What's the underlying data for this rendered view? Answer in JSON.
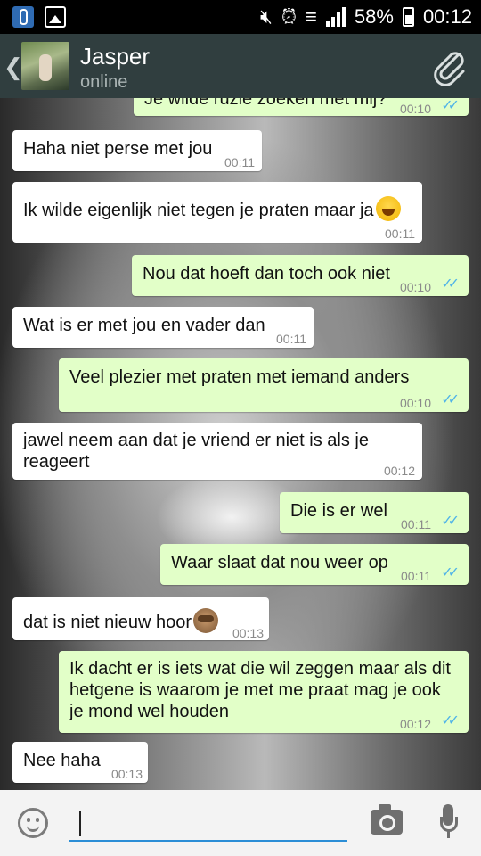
{
  "status_bar": {
    "battery": "58%",
    "time": "00:12",
    "icons": [
      "thermometer-icon",
      "gallery-icon",
      "mute-icon",
      "alarm-icon",
      "wifi-icon",
      "signal-icon",
      "battery-charging-icon"
    ]
  },
  "header": {
    "contact_name": "Jasper",
    "contact_status": "online",
    "icons": [
      "back-icon",
      "avatar",
      "attach-icon"
    ]
  },
  "messages": [
    {
      "dir": "out",
      "text": "Je wilde ruzie zoeken met mij?",
      "time": "00:10",
      "read": true
    },
    {
      "dir": "in",
      "text": "Haha niet perse met jou",
      "time": "00:11"
    },
    {
      "dir": "in",
      "text": "Ik wilde eigenlijk niet tegen je praten maar ja",
      "emoji": "face-with-tears-of-joy",
      "time": "00:11"
    },
    {
      "dir": "out",
      "text": "Nou dat hoeft dan toch ook niet",
      "time": "00:10",
      "read": true
    },
    {
      "dir": "in",
      "text": "Wat is er met jou en vader dan",
      "time": "00:11"
    },
    {
      "dir": "out",
      "text": "Veel plezier met praten met iemand anders",
      "time": "00:10",
      "read": true
    },
    {
      "dir": "in",
      "lines": [
        "jawel neem aan dat je vriend er niet is als je",
        "reageert"
      ],
      "time": "00:12"
    },
    {
      "dir": "out",
      "text": "Die is er wel",
      "time": "00:11",
      "read": true
    },
    {
      "dir": "out",
      "text": "Waar slaat dat nou weer op",
      "time": "00:11",
      "read": true
    },
    {
      "dir": "in",
      "text": "dat is niet nieuw hoor",
      "emoji": "see-no-evil-monkey",
      "time": "00:13"
    },
    {
      "dir": "out",
      "lines": [
        "Ik dacht er is iets wat die wil zeggen maar als dit",
        "hetgene is waarom je met me praat mag je ook",
        "je mond wel houden"
      ],
      "time": "00:12",
      "read": true
    },
    {
      "dir": "in",
      "text": "Nee haha",
      "time": "00:13"
    }
  ],
  "input_bar": {
    "placeholder": "",
    "icons": [
      "smiley-icon",
      "camera-icon",
      "mic-icon"
    ]
  }
}
